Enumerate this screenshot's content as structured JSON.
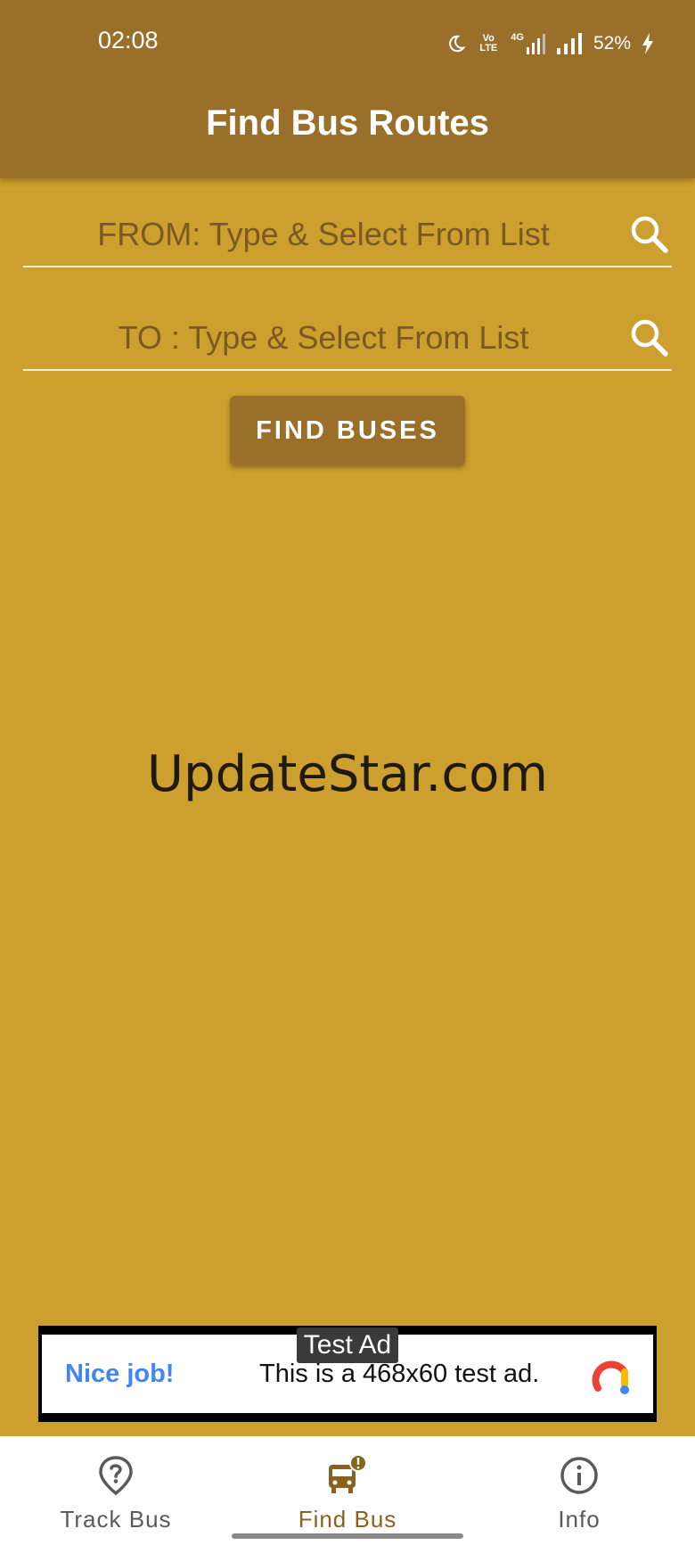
{
  "status_bar": {
    "time": "02:08",
    "battery": "52%",
    "volte": "Vo LTE",
    "network": "4G"
  },
  "header": {
    "title": "Find Bus Routes"
  },
  "form": {
    "from_placeholder": "FROM: Type & Select From List",
    "to_placeholder": "TO : Type & Select From List",
    "find_button": "FIND BUSES"
  },
  "watermark": "UpdateStar.com",
  "ad": {
    "label": "Test Ad",
    "headline": "Nice job!",
    "body": "This is a 468x60 test ad."
  },
  "bottom_nav": {
    "items": [
      {
        "label": "Track Bus",
        "icon": "location-question-icon",
        "active": false
      },
      {
        "label": "Find Bus",
        "icon": "bus-alert-icon",
        "active": true
      },
      {
        "label": "Info",
        "icon": "info-icon",
        "active": false
      }
    ]
  },
  "colors": {
    "app_bar": "#9A6F2A",
    "background": "#CC9F2E",
    "button": "#9A6F2A",
    "active_nav": "#8A6220"
  }
}
